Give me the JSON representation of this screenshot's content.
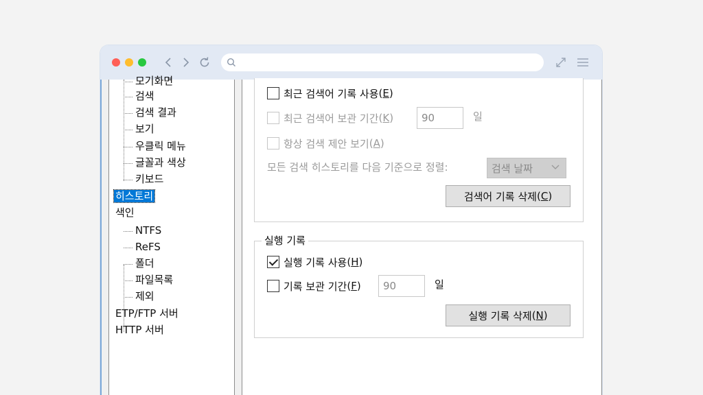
{
  "browser": {
    "address_placeholder": ""
  },
  "tree": {
    "items": [
      {
        "label": "모기화면",
        "level": 1
      },
      {
        "label": "검색",
        "level": 1
      },
      {
        "label": "검색 결과",
        "level": 1
      },
      {
        "label": "보기",
        "level": 1
      },
      {
        "label": "우클릭 메뉴",
        "level": 1
      },
      {
        "label": "글꼴과 색상",
        "level": 1
      },
      {
        "label": "키보드",
        "level": 1
      },
      {
        "label": "히스토리",
        "level": 0,
        "selected": true
      },
      {
        "label": "색인",
        "level": 0
      },
      {
        "label": "NTFS",
        "level": 1
      },
      {
        "label": "ReFS",
        "level": 1
      },
      {
        "label": "폴더",
        "level": 1
      },
      {
        "label": "파일목록",
        "level": 1
      },
      {
        "label": "제외",
        "level": 1
      },
      {
        "label": "ETP/FTP 서버",
        "level": 0
      },
      {
        "label": "HTTP 서버",
        "level": 0
      }
    ]
  },
  "search_history": {
    "enable": {
      "label": "최근 검색어 기록 사용",
      "key": "E",
      "checked": false
    },
    "keep": {
      "label": "최근 검색어 보관 기간",
      "key": "K",
      "checked": false,
      "value": "90",
      "unit": "일"
    },
    "suggest": {
      "label": "항상 검색 제안 보기",
      "key": "A",
      "checked": false
    },
    "sort_label": "모든 검색 히스토리를 다음 기준으로 정렬:",
    "sort_value": "검색 날짜",
    "delete_button": {
      "label": "검색어 기록 삭제",
      "key": "C"
    }
  },
  "run_history": {
    "title": "실행 기록",
    "enable": {
      "label": "실행 기록 사용",
      "key": "H",
      "checked": true
    },
    "keep": {
      "label": "기록 보관 기간",
      "key": "F",
      "checked": false,
      "value": "90",
      "unit": "일"
    },
    "delete_button": {
      "label": "실행 기록 삭제",
      "key": "N"
    }
  },
  "colors": {
    "selection": "#0078d7",
    "titlebar": "#e2e9f4",
    "window_border": "#7aa7d9"
  }
}
